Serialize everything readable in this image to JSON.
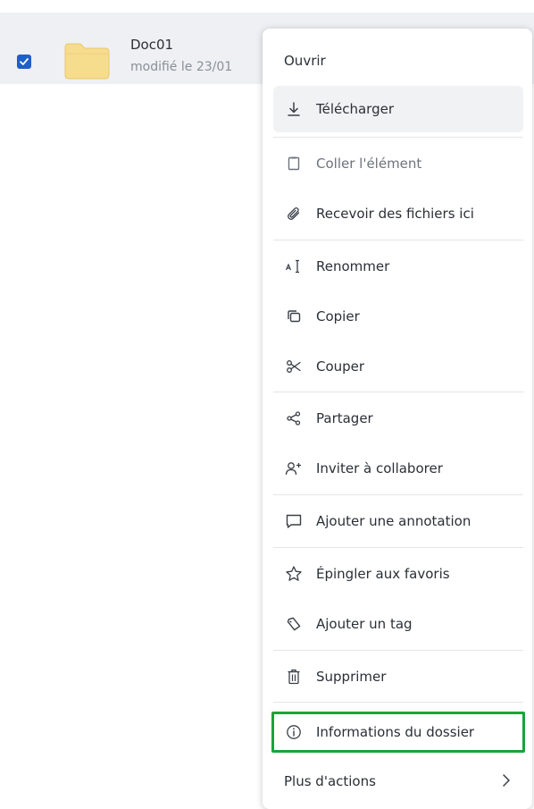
{
  "file": {
    "name": "Doc01",
    "meta": "modifié le 23/01"
  },
  "menu": {
    "open": "Ouvrir",
    "download": "Télécharger",
    "paste": "Coller l'élément",
    "receive": "Recevoir des fichiers ici",
    "rename": "Renommer",
    "copy": "Copier",
    "cut": "Couper",
    "share": "Partager",
    "invite": "Inviter à collaborer",
    "annotate": "Ajouter une annotation",
    "pin": "Épingler aux favoris",
    "tag": "Ajouter un tag",
    "delete": "Supprimer",
    "info": "Informations du dossier",
    "more": "Plus d'actions"
  },
  "colors": {
    "accent": "#1f5fc7",
    "folder": "#f6dc8d",
    "highlight_border": "#1aa33a"
  },
  "icons": {
    "download": "download-icon",
    "paste": "clipboard-icon",
    "receive": "paperclip-icon",
    "rename": "text-cursor-icon",
    "copy": "copy-icon",
    "cut": "scissors-icon",
    "share": "share-icon",
    "invite": "add-user-icon",
    "annotate": "comment-icon",
    "pin": "star-icon",
    "tag": "tag-icon",
    "delete": "trash-icon",
    "info": "info-icon",
    "more": "chevron-right-icon"
  }
}
